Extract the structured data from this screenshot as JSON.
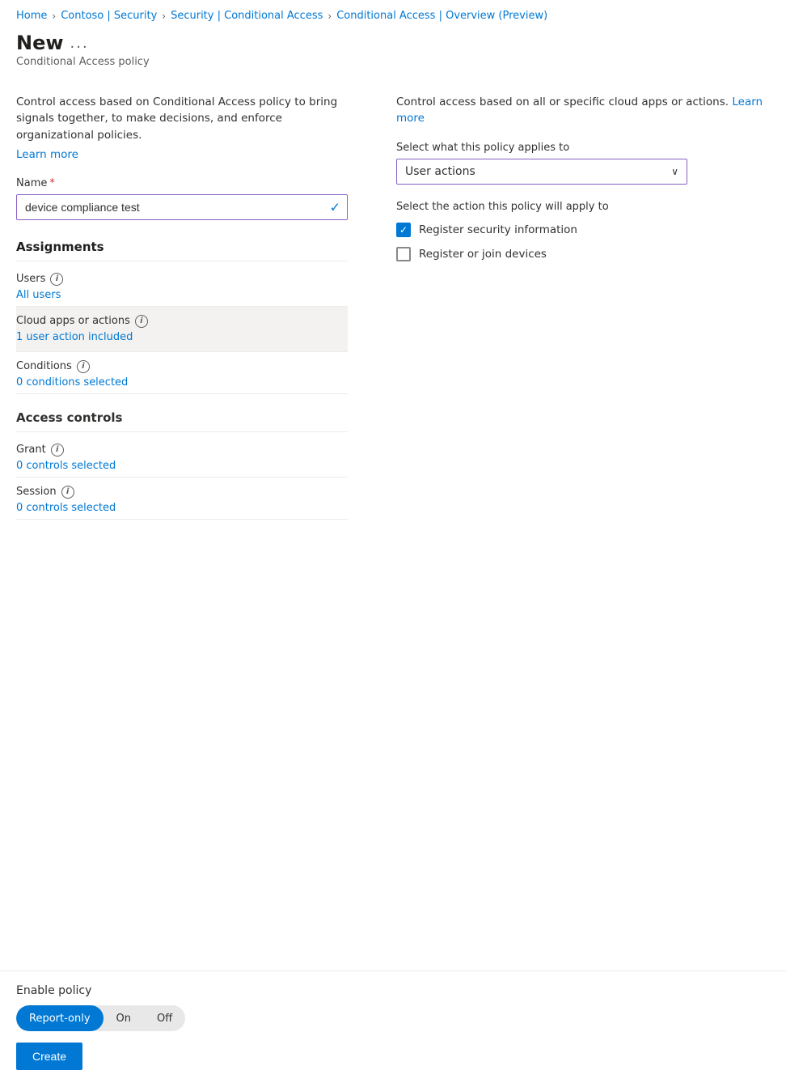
{
  "breadcrumb": {
    "items": [
      {
        "label": "Home",
        "sep": false
      },
      {
        "label": "Contoso | Security",
        "sep": true
      },
      {
        "label": "Security | Conditional Access",
        "sep": true
      },
      {
        "label": "Conditional Access | Overview (Preview)",
        "sep": true
      }
    ]
  },
  "page": {
    "title": "New",
    "title_ellipsis": "...",
    "subtitle": "Conditional Access policy"
  },
  "left": {
    "description": "Control access based on Conditional Access policy to bring signals together, to make decisions, and enforce organizational policies.",
    "learn_more": "Learn more",
    "name_label": "Name",
    "name_value": "device compliance test",
    "assignments_header": "Assignments",
    "users_label": "Users",
    "users_value": "All users",
    "cloud_apps_label": "Cloud apps or actions",
    "cloud_apps_value": "1 user action included",
    "conditions_label": "Conditions",
    "conditions_value": "0 conditions selected",
    "access_controls_header": "Access controls",
    "grant_label": "Grant",
    "grant_value": "0 controls selected",
    "session_label": "Session",
    "session_value": "0 controls selected"
  },
  "right": {
    "description": "Control access based on all or specific cloud apps or actions.",
    "learn_more": "Learn more",
    "applies_label": "Select what this policy applies to",
    "dropdown_value": "User actions",
    "action_label": "Select the action this policy will apply to",
    "checkbox1_label": "Register security information",
    "checkbox1_checked": true,
    "checkbox2_label": "Register or join devices",
    "checkbox2_checked": false
  },
  "footer": {
    "enable_label": "Enable policy",
    "toggle_options": [
      {
        "label": "Report-only",
        "active": true
      },
      {
        "label": "On",
        "active": false
      },
      {
        "label": "Off",
        "active": false
      }
    ],
    "create_button": "Create"
  }
}
